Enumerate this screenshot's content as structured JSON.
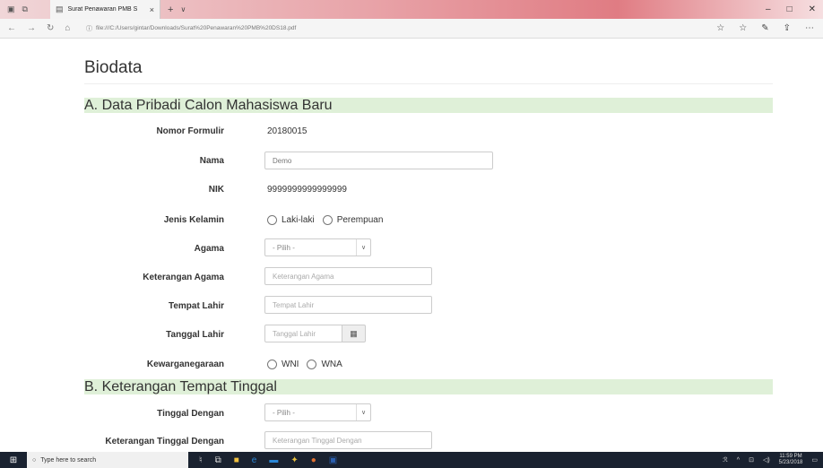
{
  "browser": {
    "tab_title": "Surat Penawaran PMB S",
    "tab_close": "×",
    "new_tab": "+",
    "tab_more": "∨",
    "url": "file:///C:/Users/gintar/Downloads/Surat%20Penawaran%20PMB%20DS18.pdf"
  },
  "page": {
    "title": "Biodata",
    "section_a": "A. Data Pribadi Calon Mahasiswa Baru",
    "section_b": "B. Keterangan Tempat Tinggal"
  },
  "form": {
    "nomor_formulir_label": "Nomor Formulir",
    "nomor_formulir_value": "20180015",
    "nama_label": "Nama",
    "nama_value": "Demo",
    "nik_label": "NIK",
    "nik_value": "9999999999999999",
    "jenis_kelamin_label": "Jenis Kelamin",
    "jk_option_1": "Laki-laki",
    "jk_option_2": "Perempuan",
    "agama_label": "Agama",
    "agama_selected": "- Pilih -",
    "keterangan_agama_label": "Keterangan Agama",
    "keterangan_agama_placeholder": "Keterangan Agama",
    "tempat_lahir_label": "Tempat Lahir",
    "tempat_lahir_placeholder": "Tempat Lahir",
    "tanggal_lahir_label": "Tanggal Lahir",
    "tanggal_lahir_placeholder": "Tanggal Lahir",
    "kewarganegaraan_label": "Kewarganegaraan",
    "kw_option_1": "WNI",
    "kw_option_2": "WNA",
    "tinggal_dengan_label": "Tinggal Dengan",
    "tinggal_dengan_selected": "- Pilih -",
    "keterangan_tinggal_label": "Keterangan Tinggal Dengan",
    "keterangan_tinggal_placeholder": "Keterangan Tinggal Dengan"
  },
  "taskbar": {
    "search_placeholder": "Type here to search",
    "time": "11:59 PM",
    "date": "5/23/2018"
  },
  "colors": {
    "section_bg": "#dff0d8",
    "taskbar_bg": "#1a2230"
  }
}
